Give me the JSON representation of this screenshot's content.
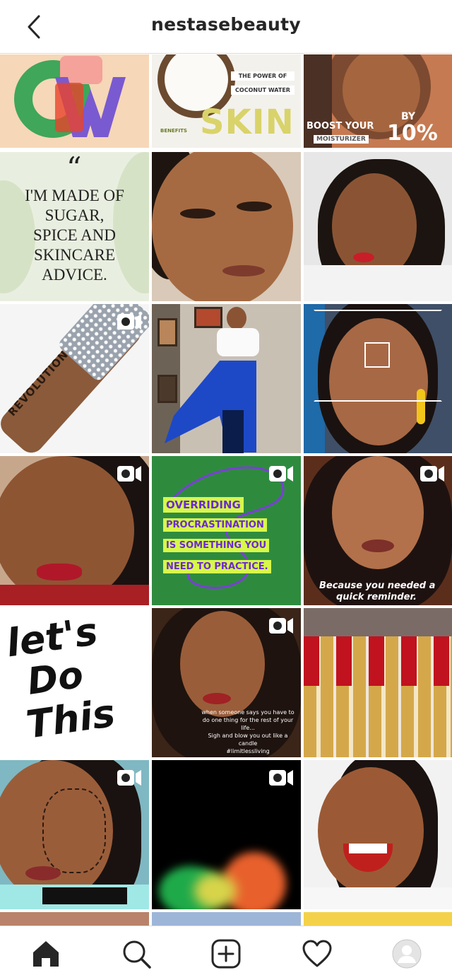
{
  "header": {
    "username": "nestasebeauty"
  },
  "posts": {
    "coconut": {
      "line1": "THE POWER OF",
      "line2": "COCONUT WATER",
      "benefits": "BENEFITS",
      "skin": "SKIN"
    },
    "boost": {
      "line1": "BOOST YOUR",
      "line2": "MOISTURIZER",
      "by": "BY",
      "pct": "10%"
    },
    "quote": {
      "mark": "“",
      "text_lines": [
        "I'M MADE OF",
        "SUGAR,",
        "SPICE AND",
        "SKINCARE",
        "ADVICE."
      ]
    },
    "revolution": {
      "brand": "REVOLUTION"
    },
    "procrastination": {
      "lines": [
        "OVERRIDING",
        "PROCRASTINATION",
        "IS SOMETHING YOU",
        "NEED TO PRACTICE."
      ]
    },
    "reminder": {
      "line1": "Because you needed a",
      "line2": "quick reminder."
    },
    "letsdo": {
      "lines": [
        "let's",
        "Do",
        "This"
      ]
    },
    "limitless": {
      "lines": [
        "when someone says you have to",
        "do one thing for the rest of your",
        "life...",
        "Sigh and blow you out like a",
        "candle",
        "#limitlessliving"
      ]
    }
  },
  "colors": {
    "accent_green": "#2e8b3e",
    "highlight_yellow": "#d7f74b",
    "text_dark": "#262626"
  },
  "icons": {
    "back": "chevron-left-icon",
    "video": "video-camera-icon",
    "home": "home-icon",
    "search": "search-icon",
    "add": "add-post-icon",
    "activity": "heart-icon",
    "profile": "avatar-icon"
  }
}
